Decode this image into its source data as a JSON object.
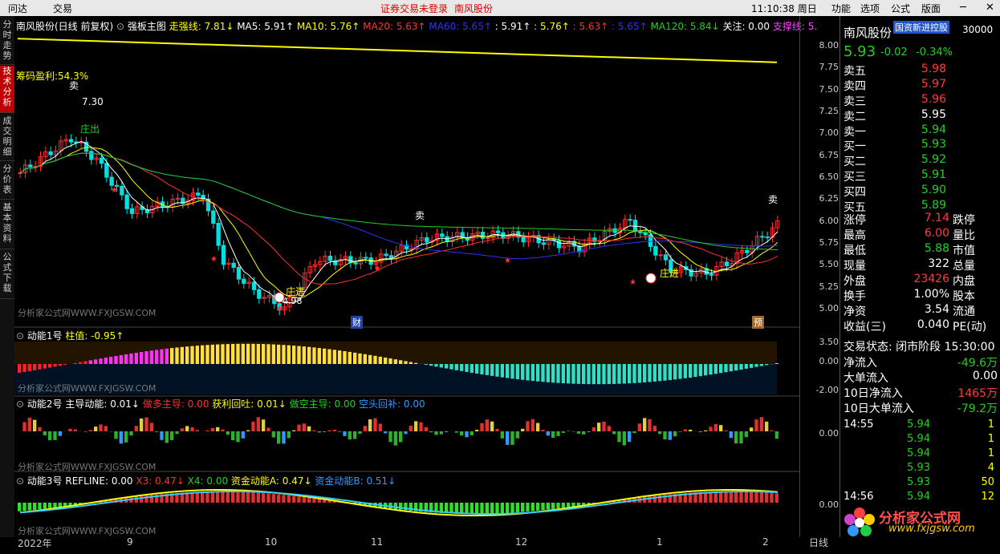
{
  "menu": {
    "left": [
      "问达",
      "交易"
    ],
    "center": [
      "证券交易未登录",
      "南风股份"
    ],
    "clock": "11:10:38 周日",
    "right": [
      "功能",
      "选项",
      "公式",
      "版面"
    ]
  },
  "side_tabs": [
    "分时走势",
    "技术分析",
    "成交明细",
    "分价表",
    "基本资料",
    "公式下载"
  ],
  "main_chart": {
    "stock": "南风股份(日线 前复权)",
    "indicator": "强板主图",
    "legend": [
      {
        "label": "走强线: 7.81↓",
        "color": "#ffff00"
      },
      {
        "label": "MA5: 5.91↑",
        "color": "#ffffff"
      },
      {
        "label": "MA10: 5.76↑",
        "color": "#ffff00"
      },
      {
        "label": "MA20: 5.63↑",
        "color": "#ff3030"
      },
      {
        "label": "MA60: 5.65↑",
        "color": "#3030ff"
      },
      {
        "label": ": 5.91↑",
        "color": "#ffffff"
      },
      {
        "label": ": 5.76↑",
        "color": "#ffff00"
      },
      {
        "label": ": 5.63↑",
        "color": "#ff3030"
      },
      {
        "label": ": 5.65↑",
        "color": "#3030ff"
      },
      {
        "label": "MA120: 5.84↓",
        "color": "#22d022"
      },
      {
        "label": "关注: 0.00",
        "color": "#ffffff"
      },
      {
        "label": "支撑线: 5.",
        "color": "#ff40ff"
      }
    ],
    "chip_profit": "筹码盈利:54.3%",
    "high_note": "7.30",
    "low_note": "4.98",
    "labels": {
      "sell": "卖",
      "zhuangchu": "庄出",
      "zhuangjin": "庄进",
      "cai": "财",
      "yu": "预"
    },
    "watermark": "分析家公式网WWW.FXJGSW.COM",
    "ylim": [
      4.9,
      8.1
    ],
    "y_ticks": [
      "8.00",
      "7.75",
      "7.50",
      "7.25",
      "7.00",
      "6.75",
      "6.50",
      "6.25",
      "6.00",
      "5.75",
      "5.50",
      "5.25",
      "5.00"
    ]
  },
  "sub1": {
    "name": "动能1号",
    "legend": "柱值: -0.95↑",
    "y_ticks": [
      "3.50",
      "0.00",
      "-2.00"
    ]
  },
  "sub2": {
    "name": "动能2号",
    "legend": [
      {
        "label": "主导动能: 0.01↓",
        "color": "#ffffff"
      },
      {
        "label": "做多主导: 0.00",
        "color": "#ff3030"
      },
      {
        "label": "获利回吐: 0.01↓",
        "color": "#ffff00"
      },
      {
        "label": "做空主导: 0.00",
        "color": "#22d022"
      },
      {
        "label": "空头回补: 0.00",
        "color": "#3399ff"
      }
    ],
    "y_ticks": [
      "0.00"
    ]
  },
  "sub3": {
    "name": "动能3号",
    "legend": [
      {
        "label": "REFLINE: 0.00",
        "color": "#ffffff"
      },
      {
        "label": "X3: 0.47↓",
        "color": "#ff3030"
      },
      {
        "label": "X4: 0.00",
        "color": "#22d022"
      },
      {
        "label": "资金动能A: 0.47↓",
        "color": "#ffff00"
      },
      {
        "label": "资金动能B: 0.51↓",
        "color": "#3399ff"
      }
    ],
    "y_ticks": [
      "0.00"
    ]
  },
  "x_axis": {
    "labels": [
      "2022年",
      "9",
      "10",
      "11",
      "12",
      "1",
      "2"
    ],
    "period": "日线"
  },
  "quote": {
    "name": "南风股份",
    "tag": "国资新进控股",
    "code": "30000",
    "price": "5.93",
    "change": "-0.02",
    "pct": "-0.34%",
    "asks": [
      {
        "l": "卖五",
        "p": "5.98",
        "v": "",
        "c": "red"
      },
      {
        "l": "卖四",
        "p": "5.97",
        "v": "",
        "c": "red"
      },
      {
        "l": "卖三",
        "p": "5.96",
        "v": "",
        "c": "red"
      },
      {
        "l": "卖二",
        "p": "5.95",
        "v": "",
        "c": "white"
      },
      {
        "l": "卖一",
        "p": "5.94",
        "v": "",
        "c": "green"
      }
    ],
    "bids": [
      {
        "l": "买一",
        "p": "5.93",
        "v": "",
        "c": "green"
      },
      {
        "l": "买二",
        "p": "5.92",
        "v": "",
        "c": "green"
      },
      {
        "l": "买三",
        "p": "5.91",
        "v": "",
        "c": "green"
      },
      {
        "l": "买四",
        "p": "5.90",
        "v": "",
        "c": "green"
      },
      {
        "l": "买五",
        "p": "5.89",
        "v": "",
        "c": "green"
      }
    ],
    "stats": [
      {
        "l": "涨停",
        "v": "7.14",
        "c": "red",
        "r": "跌停"
      },
      {
        "l": "最高",
        "v": "6.00",
        "c": "red",
        "r": "量比"
      },
      {
        "l": "最低",
        "v": "5.88",
        "c": "green",
        "r": "市值"
      },
      {
        "l": "现量",
        "v": "322",
        "c": "white",
        "r": "总量"
      },
      {
        "l": "外盘",
        "v": "23426",
        "c": "red",
        "r": "内盘"
      },
      {
        "l": "换手",
        "v": "1.00%",
        "c": "white",
        "r": "股本"
      },
      {
        "l": "净资",
        "v": "3.54",
        "c": "white",
        "r": "流通"
      },
      {
        "l": "收益(三)",
        "v": "0.040",
        "c": "white",
        "r": "PE(动)"
      }
    ],
    "status": "交易状态: 闭市阶段 15:30:00",
    "flows": [
      {
        "l": "净流入",
        "v": "-49.6万",
        "c": "green"
      },
      {
        "l": "大单流入",
        "v": "0.00",
        "c": "white"
      },
      {
        "l": "10日净流入",
        "v": "1465万",
        "c": "red"
      },
      {
        "l": "10日大单流入",
        "v": "-79.2万",
        "c": "green"
      }
    ],
    "ticks": [
      {
        "t": "14:55",
        "p": "5.94",
        "v": "1"
      },
      {
        "t": "",
        "p": "5.94",
        "v": "1"
      },
      {
        "t": "",
        "p": "5.94",
        "v": "1"
      },
      {
        "t": "",
        "p": "5.93",
        "v": "4"
      },
      {
        "t": "",
        "p": "5.93",
        "v": "50"
      },
      {
        "t": "14:56",
        "p": "5.94",
        "v": "12"
      }
    ],
    "logo": "分析家公式网",
    "logo_url": "www.fxjgsw.com"
  },
  "colors": {
    "up": "#ff3030",
    "down": "#00e0e0",
    "ma5": "#ffffff",
    "ma10": "#ffff00",
    "ma20": "#ff3030",
    "ma60": "#3030ff",
    "ma120": "#22d022",
    "zqx": "#ffff00"
  }
}
